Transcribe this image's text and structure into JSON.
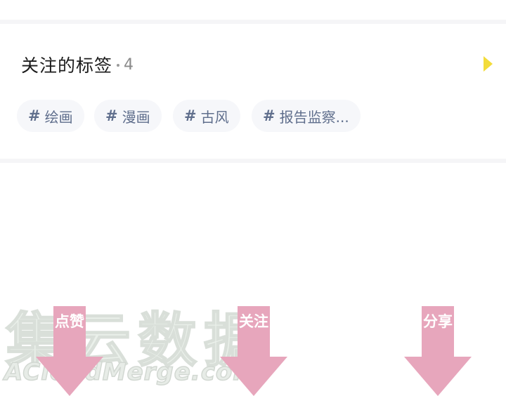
{
  "section": {
    "title": "关注的标签",
    "count": "4"
  },
  "tags": [
    {
      "hash": "#",
      "label": "绘画"
    },
    {
      "hash": "#",
      "label": "漫画"
    },
    {
      "hash": "#",
      "label": "古风"
    },
    {
      "hash": "#",
      "label": "报告监察..."
    }
  ],
  "watermark": {
    "text": "集云数据",
    "url": "ACloudMerge.com"
  },
  "cues": {
    "like": "点赞",
    "follow": "关注",
    "share": "分享"
  },
  "colors": {
    "accent_arrow": "#f3dc3a",
    "tag_text": "#5f6e8c",
    "tag_bg": "#f6f7fa",
    "cue_pink": "#e7a6bc"
  },
  "icons": {
    "expand": "triangle-right-icon",
    "cue": "arrow-down-icon"
  }
}
